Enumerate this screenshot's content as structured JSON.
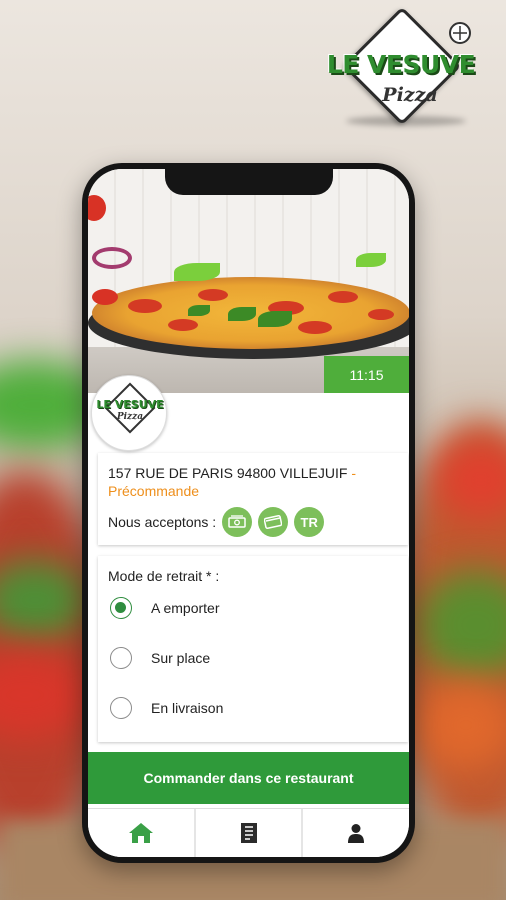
{
  "brand": {
    "logo_word": "LE VESUVE",
    "logo_sub": "Pizza"
  },
  "store": {
    "time": "11:15",
    "address": "157 RUE DE PARIS 94800 VILLEJUIF",
    "separator": "-",
    "status": "Précommande",
    "accept_label": "Nous acceptons :",
    "payment_methods": [
      {
        "icon": "cash-icon",
        "text": ""
      },
      {
        "icon": "card-icon",
        "text": ""
      },
      {
        "icon": "ticket-restaurant-icon",
        "text": "TR"
      }
    ]
  },
  "mode": {
    "title": "Mode de retrait * :",
    "options": [
      {
        "label": "A emporter",
        "selected": true
      },
      {
        "label": "Sur place",
        "selected": false
      },
      {
        "label": "En livraison",
        "selected": false
      }
    ]
  },
  "order_button": "Commander dans ce restaurant",
  "navbar": {
    "items": [
      {
        "icon": "home-icon",
        "active": true
      },
      {
        "icon": "menu-book-icon",
        "active": false
      },
      {
        "icon": "user-icon",
        "active": false
      }
    ]
  },
  "colors": {
    "accent_green": "#2f9a3a",
    "orange": "#ee8f1c",
    "badge_green": "#4fae3b"
  }
}
